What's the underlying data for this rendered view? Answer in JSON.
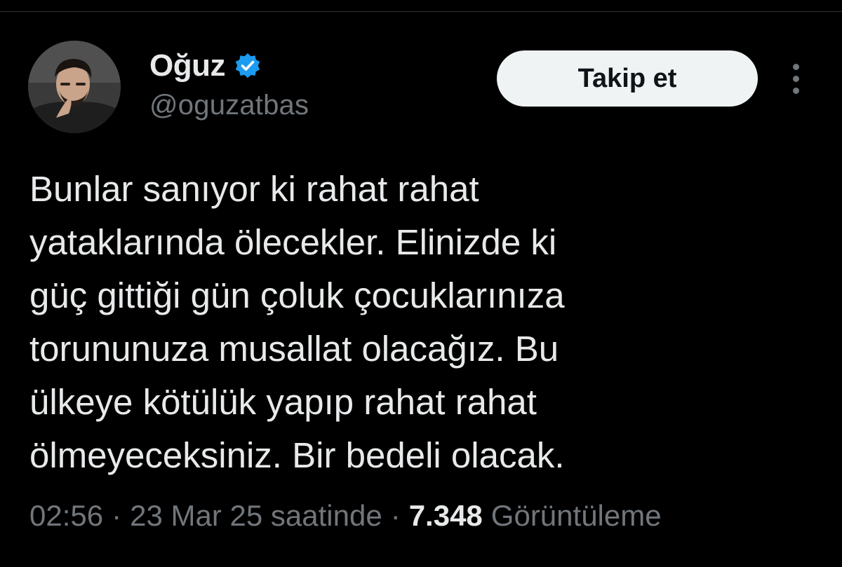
{
  "author": {
    "display_name": "Oğuz",
    "handle": "@oguzatbas",
    "verified": true,
    "badge_icon": "verified-badge-icon",
    "badge_color": "#1d9bf0"
  },
  "actions": {
    "follow_label": "Takip et",
    "more_icon": "more-vertical-icon"
  },
  "tweet": {
    "lines": [
      "Bunlar sanıyor ki rahat rahat",
      "yataklarında ölecekler. Elinizde ki",
      "güç gittiği gün çoluk çocuklarınıza",
      "torununuza musallat olacağız. Bu",
      "ülkeye kötülük yapıp rahat rahat",
      "ölmeyeceksiniz. Bir bedeli olacak."
    ]
  },
  "meta": {
    "time": "02:56",
    "separator": "·",
    "date_text": "23 Mar 25 saatinde",
    "views_count": "7.348",
    "views_label": "Görüntüleme"
  },
  "colors": {
    "background": "#000000",
    "text_primary": "#e7e9ea",
    "text_secondary": "#71767b",
    "button_bg": "#eff3f4",
    "button_text": "#0f1419"
  }
}
